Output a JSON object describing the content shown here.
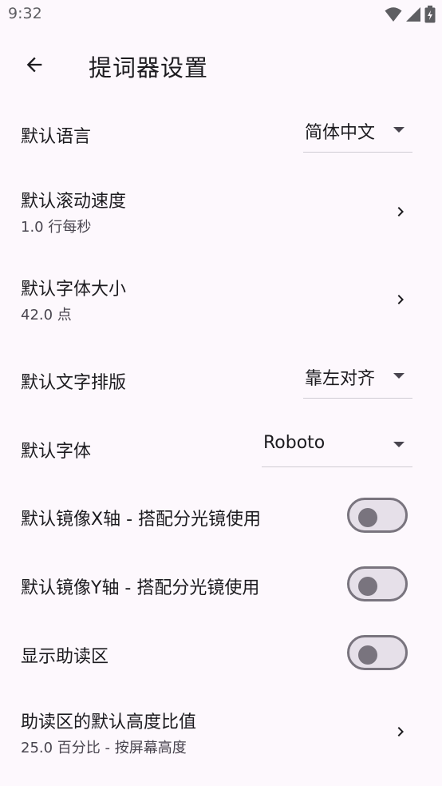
{
  "status_bar": {
    "time": "9:32",
    "icons": [
      "wifi-icon",
      "cellular-signal-icon",
      "battery-icon"
    ]
  },
  "app_bar": {
    "title": "提词器设置",
    "back_icon": "arrow-back-icon"
  },
  "settings": {
    "default_language": {
      "label": "默认语言",
      "value": "简体中文"
    },
    "default_scroll_speed": {
      "label": "默认滚动速度",
      "summary": "1.0 行每秒"
    },
    "default_font_size": {
      "label": "默认字体大小",
      "summary": "42.0 点"
    },
    "default_text_alignment": {
      "label": "默认文字排版",
      "value": "靠左对齐"
    },
    "default_font": {
      "label": "默认字体",
      "value": "Roboto"
    },
    "mirror_x": {
      "label": "默认镜像X轴 - 搭配分光镜使用",
      "checked": false
    },
    "mirror_y": {
      "label": "默认镜像Y轴 - 搭配分光镜使用",
      "checked": false
    },
    "show_reading_zone": {
      "label": "显示助读区",
      "checked": false
    },
    "reading_zone_height": {
      "label": "助读区的默认高度比值",
      "summary": "25.0 百分比 - 按屏幕高度"
    }
  },
  "colors": {
    "background": "#fdf8fd",
    "switch_track": "#e6e0e9",
    "switch_outline": "#79747e"
  }
}
